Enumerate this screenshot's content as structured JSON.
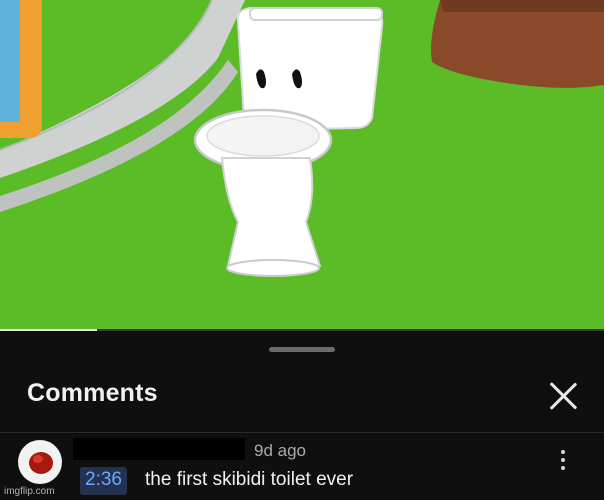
{
  "video": {
    "progress_fraction": 0.16,
    "colors": {
      "grass": "#5cbc28",
      "path": "#d8d8d8",
      "toilet": "#ffffff"
    }
  },
  "comments_panel": {
    "title": "Comments",
    "close_icon": "close-icon",
    "comment": {
      "author_redacted": true,
      "time_ago": "9d ago",
      "timestamp_link": "2:36",
      "text": "the first skibidi toilet ever",
      "more_icon": "more-vertical-icon"
    }
  },
  "watermark": "imgflip.com"
}
